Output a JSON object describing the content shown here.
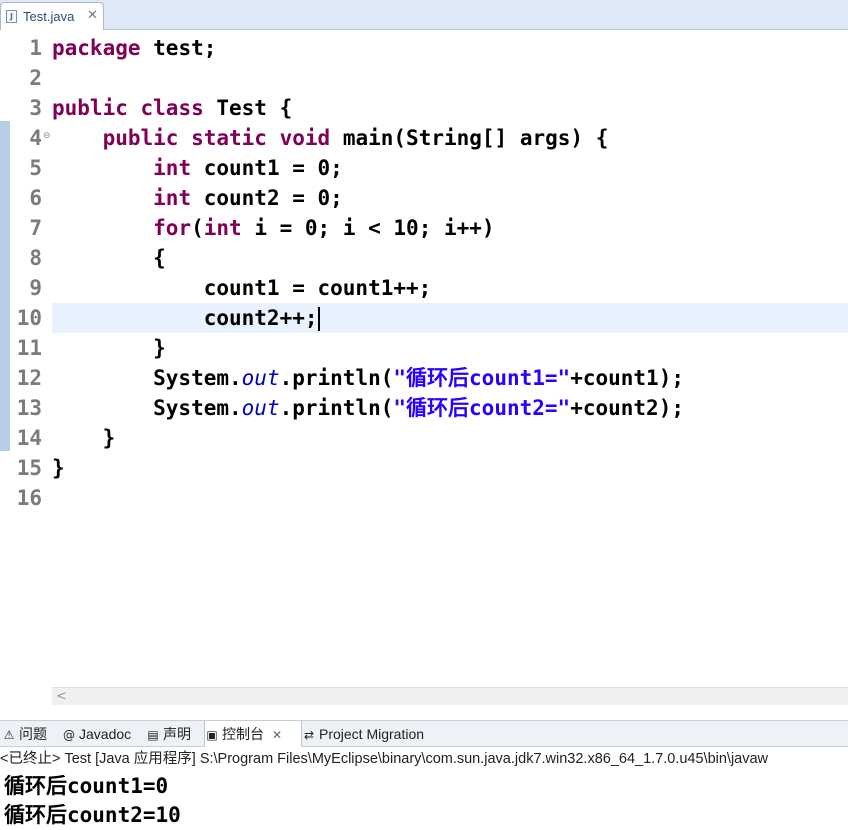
{
  "editor_tab": {
    "label": "Test.java",
    "close": "✕",
    "icon": "java-file-icon"
  },
  "code_lines": [
    {
      "n": "1",
      "segs": [
        {
          "t": "package",
          "c": "kw"
        },
        {
          "t": " test;"
        }
      ]
    },
    {
      "n": "2",
      "segs": []
    },
    {
      "n": "3",
      "segs": [
        {
          "t": "public",
          "c": "kw"
        },
        {
          "t": " "
        },
        {
          "t": "class",
          "c": "kw"
        },
        {
          "t": " Test {"
        }
      ]
    },
    {
      "n": "4",
      "fold": true,
      "segs": [
        {
          "t": "    "
        },
        {
          "t": "public",
          "c": "kw"
        },
        {
          "t": " "
        },
        {
          "t": "static",
          "c": "kw"
        },
        {
          "t": " "
        },
        {
          "t": "void",
          "c": "kw"
        },
        {
          "t": " main(String[] args) {"
        }
      ]
    },
    {
      "n": "5",
      "segs": [
        {
          "t": "        "
        },
        {
          "t": "int",
          "c": "kw"
        },
        {
          "t": " count1 = 0;"
        }
      ]
    },
    {
      "n": "6",
      "segs": [
        {
          "t": "        "
        },
        {
          "t": "int",
          "c": "kw"
        },
        {
          "t": " count2 = 0;"
        }
      ]
    },
    {
      "n": "7",
      "segs": [
        {
          "t": "        "
        },
        {
          "t": "for",
          "c": "kw"
        },
        {
          "t": "("
        },
        {
          "t": "int",
          "c": "kw"
        },
        {
          "t": " i = 0; i < 10; i++)"
        }
      ]
    },
    {
      "n": "8",
      "segs": [
        {
          "t": "        {"
        }
      ]
    },
    {
      "n": "9",
      "segs": [
        {
          "t": "            count1 = count1++;"
        }
      ]
    },
    {
      "n": "10",
      "current": true,
      "caret": true,
      "segs": [
        {
          "t": "            count2++;"
        }
      ]
    },
    {
      "n": "11",
      "segs": [
        {
          "t": "        }"
        }
      ]
    },
    {
      "n": "12",
      "segs": [
        {
          "t": "        System."
        },
        {
          "t": "out",
          "c": "fld"
        },
        {
          "t": ".println("
        },
        {
          "t": "\"循环后count1=\"",
          "c": "str"
        },
        {
          "t": "+count1);"
        }
      ]
    },
    {
      "n": "13",
      "segs": [
        {
          "t": "        System."
        },
        {
          "t": "out",
          "c": "fld"
        },
        {
          "t": ".println("
        },
        {
          "t": "\"循环后count2=\"",
          "c": "str"
        },
        {
          "t": "+count2);"
        }
      ]
    },
    {
      "n": "14",
      "segs": [
        {
          "t": "    }"
        }
      ]
    },
    {
      "n": "15",
      "segs": [
        {
          "t": "}"
        }
      ]
    },
    {
      "n": "16",
      "segs": []
    }
  ],
  "scrollbar": {
    "left_arrow": "<"
  },
  "panel_tabs": [
    {
      "label": "问题",
      "icon": "problems-icon",
      "glyph": "⚠"
    },
    {
      "label": "Javadoc",
      "icon": "javadoc-icon",
      "glyph": "@"
    },
    {
      "label": "声明",
      "icon": "declaration-icon",
      "glyph": "▤"
    },
    {
      "label": "控制台",
      "icon": "console-icon",
      "glyph": "▣",
      "active": true,
      "close": "✕"
    },
    {
      "label": "Project Migration",
      "icon": "migration-icon",
      "glyph": "⇄"
    }
  ],
  "console": {
    "header": "<已终止> Test [Java 应用程序] S:\\Program Files\\MyEclipse\\binary\\com.sun.java.jdk7.win32.x86_64_1.7.0.u45\\bin\\javaw",
    "output": [
      "循环后count1=0",
      "循环后count2=10"
    ]
  },
  "colors": {
    "keyword": "#7f0055",
    "string": "#2a00ff",
    "field": "#0000c0",
    "current_line": "#e8f2fe"
  }
}
